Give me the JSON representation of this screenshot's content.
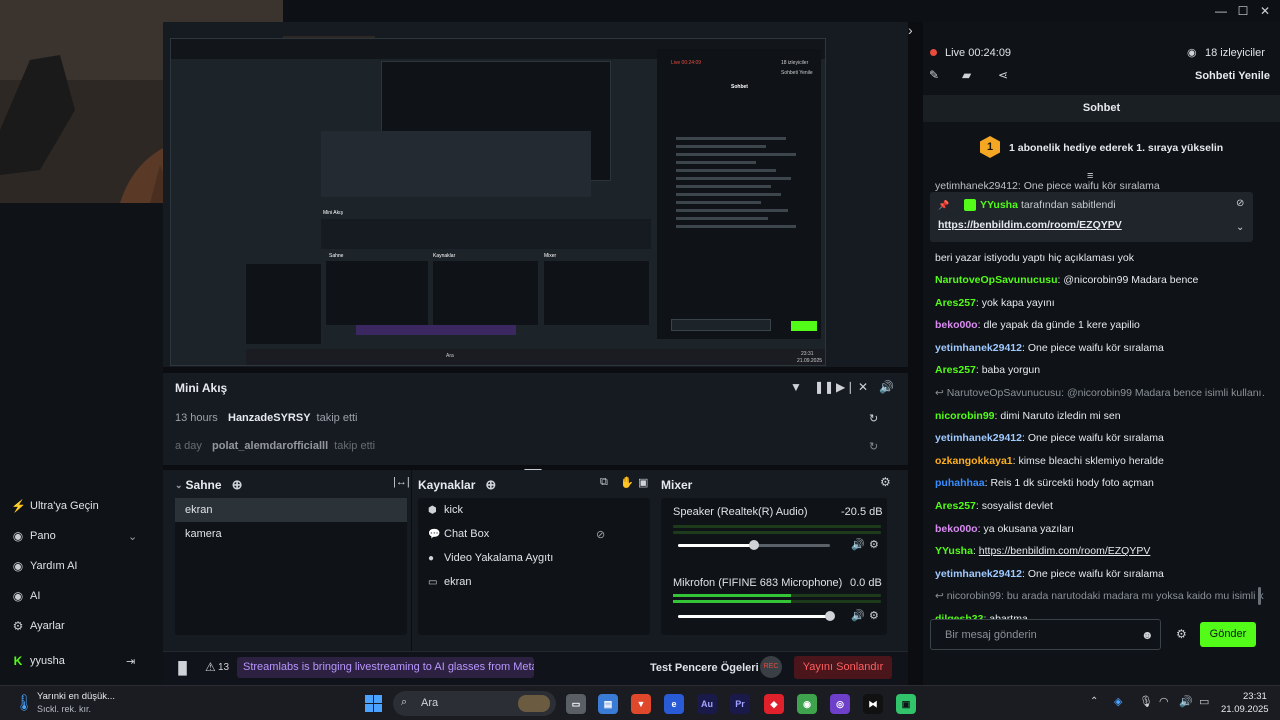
{
  "window": {
    "minimize": "—",
    "maximize": "☐",
    "close": "✕"
  },
  "sidebar": {
    "items": [
      {
        "icon": "plug-icon",
        "glyph": "⚡",
        "label": "Ultra'ya Geçin"
      },
      {
        "icon": "dashboard-icon",
        "glyph": "◉",
        "label": "Pano",
        "chevron": "⌄"
      },
      {
        "icon": "help-icon",
        "glyph": "◉",
        "label": "Yardım AI"
      },
      {
        "icon": "eye-icon",
        "glyph": "◉",
        "label": "AI"
      },
      {
        "icon": "gear-icon",
        "glyph": "⚙",
        "label": "Ayarlar"
      },
      {
        "icon": "kick-logo-icon",
        "glyph": "K",
        "label": "yyusha"
      }
    ]
  },
  "minifeed": {
    "title": "Mini Akış",
    "rows": [
      {
        "time": "13 hours",
        "user": "HanzadeSYRSY",
        "action": "takip etti"
      },
      {
        "time": "a day",
        "user": "polat_alemdarofficialll",
        "action": "takip etti"
      }
    ]
  },
  "scenes": {
    "title": "Sahne",
    "items": [
      "ekran",
      "kamera"
    ]
  },
  "sources": {
    "title": "Kaynaklar",
    "items": [
      {
        "icon": "kick-icon",
        "label": "kick"
      },
      {
        "icon": "chat-icon",
        "label": "Chat Box"
      },
      {
        "icon": "camera-icon",
        "label": "Video Yakalama Aygıtı"
      },
      {
        "icon": "monitor-icon",
        "label": "ekran"
      }
    ]
  },
  "mixer": {
    "title": "Mixer",
    "channels": [
      {
        "name": "Speaker (Realtek(R) Audio)",
        "db": "-20.5 dB",
        "volume": 0.5
      },
      {
        "name": "Mikrofon (FIFINE 683 Microphone)",
        "db": "0.0 dB",
        "volume": 1.0
      }
    ]
  },
  "statusbar": {
    "alerts": "13",
    "banner": "Streamlabs is bringing livestreaming to AI glasses from Meta",
    "test": "Test Pencere Ögeleri",
    "rec": "REC",
    "end": "Yayını Sonlandır"
  },
  "chat": {
    "live": "Live 00:24:09",
    "viewers": "18 izleyiciler",
    "refresh": "Sohbeti Yenile",
    "title": "Sohbet",
    "gift": "1 abonelik hediye ederek 1. sıraya yükselin",
    "gift_rank": "1",
    "pinned_by": "tarafından sabitlendi",
    "pinned_user": "YYusha",
    "pinned_link": "https://benbildim.com/room/EZQYPV",
    "partial_top": "yetimhanek29412: One piece waifu kör sıralama",
    "partial_line": "beri yazar istiyodu yaptı hiç açıklaması yok",
    "messages": [
      {
        "user": "NarutoveOpSavunucusu",
        "color": "#53fc18",
        "text": "@nicorobin99 Madara bence"
      },
      {
        "user": "Ares257",
        "color": "#53fc18",
        "text": "yok kapa yayını"
      },
      {
        "user": "beko00o",
        "color": "#d98bf2",
        "text": "dle yapak da günde 1 kere yapilio"
      },
      {
        "user": "yetimhanek29412",
        "color": "#9fc9ff",
        "text": "One piece waifu kör sıralama"
      },
      {
        "user": "Ares257",
        "color": "#53fc18",
        "text": "baba yorgun"
      },
      {
        "reply": "NarutoveOpSavunucusu: @nicorobin99 Madara bence isimli kullanı…"
      },
      {
        "user": "nicorobin99",
        "color": "#53fc18",
        "text": "dimi Naruto izledin mi sen"
      },
      {
        "user": "yetimhanek29412",
        "color": "#9fc9ff",
        "text": "One piece waifu kör sıralama"
      },
      {
        "user": "ozkangokkaya1",
        "color": "#ffb020",
        "text": "kimse bleachi sklemiyo heralde"
      },
      {
        "user": "puhahhaa",
        "color": "#3a8dff",
        "text": "Reis 1 dk sürcekti hody foto açman"
      },
      {
        "user": "Ares257",
        "color": "#53fc18",
        "text": "sosyalist devlet"
      },
      {
        "user": "beko00o",
        "color": "#d98bf2",
        "text": "ya okusana yazıları"
      },
      {
        "user": "YYusha",
        "color": "#53fc18",
        "text": "https://benbildim.com/room/EZQYPV",
        "link": true
      },
      {
        "user": "yetimhanek29412",
        "color": "#9fc9ff",
        "text": "One piece waifu kör sıralama"
      },
      {
        "reply": "nicorobin99: bu arada narutodaki madara mı yoksa kaido mu isimli k…"
      },
      {
        "user": "dilgesh33",
        "color": "#53fc18",
        "text": "abartma"
      }
    ],
    "input_placeholder": "Bir mesaj gönderin",
    "send": "Gönder"
  },
  "taskbar": {
    "weather_title": "Yarınki en düşük...",
    "weather_sub": "Sıckl. rek. kır.",
    "search": "Ara",
    "time": "23:31",
    "date": "21.09.2025"
  },
  "nested": {
    "live": "Live 00:24:09",
    "viewers": "18 izleyiciler",
    "refresh": "Sohbeti Yenile",
    "chat_title": "Sohbet",
    "minifeed": "Mini Akış",
    "scene": "Sahne",
    "sources": "Kaynaklar",
    "mixer": "Mixer",
    "send": "Gönder",
    "input": "Bir mesaj gönderin",
    "search": "Ara",
    "time": "23:31",
    "date": "21.09.2025"
  }
}
